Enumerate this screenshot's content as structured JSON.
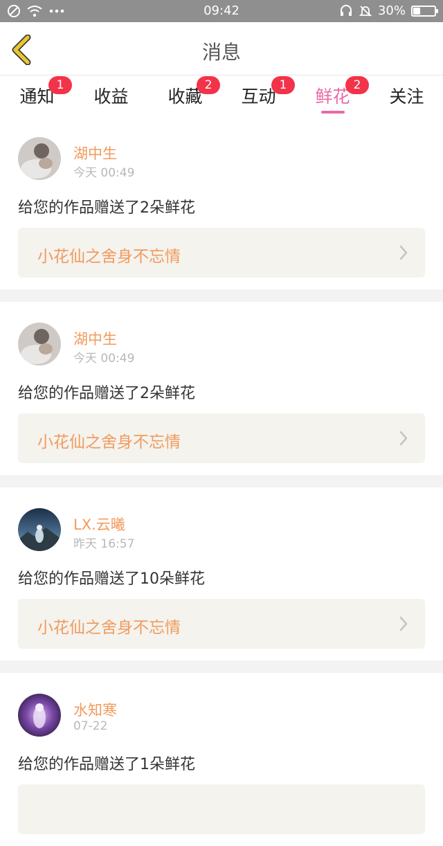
{
  "status_bar": {
    "time": "09:42",
    "battery": "30%",
    "battery_level": 0.3,
    "icons": [
      "no-disturb-icon",
      "wifi-icon",
      "more-dots-icon",
      "headset-icon",
      "mute-bell-icon",
      "battery-icon"
    ]
  },
  "header": {
    "title": "消息",
    "back_icon": "chevron-left-icon",
    "accent": "#e8c532"
  },
  "tabs": [
    {
      "label": "通知",
      "badge": "1"
    },
    {
      "label": "收益",
      "badge": ""
    },
    {
      "label": "收藏",
      "badge": "2"
    },
    {
      "label": "互动",
      "badge": "1"
    },
    {
      "label": "鲜花",
      "badge": "2",
      "active": true
    },
    {
      "label": "关注",
      "badge": ""
    }
  ],
  "colors": {
    "active_tab": "#e96aa8",
    "badge": "#f2334a",
    "name": "#f29a5c",
    "work_bg": "#f4f3ee"
  },
  "messages": [
    {
      "user": "湖中生",
      "time": "今天 00:49",
      "text": "给您的作品赠送了2朵鲜花",
      "work": "小花仙之舍身不忘情"
    },
    {
      "user": "湖中生",
      "time": "今天 00:49",
      "text": "给您的作品赠送了2朵鲜花",
      "work": "小花仙之舍身不忘情"
    },
    {
      "user": "LX.云曦",
      "time": "昨天 16:57",
      "text": "给您的作品赠送了10朵鲜花",
      "work": "小花仙之舍身不忘情"
    },
    {
      "user": "水知寒",
      "time": "07-22",
      "text": "给您的作品赠送了1朵鲜花",
      "work": ""
    }
  ]
}
